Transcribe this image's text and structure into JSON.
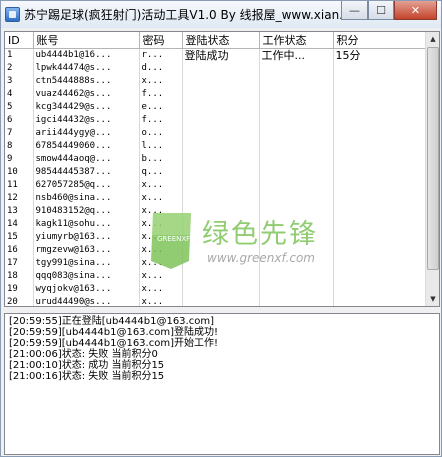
{
  "window": {
    "title": "苏宁踢足球(疯狂射门)活动工具V1.0 By 线报屋_www.xian...",
    "minimize_glyph": "—",
    "maximize_glyph": "☐",
    "close_glyph": "✕"
  },
  "grid": {
    "headers": [
      "ID",
      "账号",
      "密码",
      "登陆状态",
      "工作状态",
      "积分"
    ],
    "rows": [
      {
        "id": "1",
        "account": "ub4444b1@16...",
        "password": "r...",
        "login_status": "登陆成功",
        "work_status": "工作中...",
        "points": "15分"
      },
      {
        "id": "2",
        "account": "lpwk44474@s...",
        "password": "d...",
        "login_status": "",
        "work_status": "",
        "points": ""
      },
      {
        "id": "3",
        "account": "ctn5444888s...",
        "password": "x...",
        "login_status": "",
        "work_status": "",
        "points": ""
      },
      {
        "id": "4",
        "account": "vuaz44462@s...",
        "password": "f...",
        "login_status": "",
        "work_status": "",
        "points": ""
      },
      {
        "id": "5",
        "account": "kcg344429@s...",
        "password": "e...",
        "login_status": "",
        "work_status": "",
        "points": ""
      },
      {
        "id": "6",
        "account": "igci44432@s...",
        "password": "f...",
        "login_status": "",
        "work_status": "",
        "points": ""
      },
      {
        "id": "7",
        "account": "arii444ygy@...",
        "password": "o...",
        "login_status": "",
        "work_status": "",
        "points": ""
      },
      {
        "id": "8",
        "account": "67854449060...",
        "password": "l...",
        "login_status": "",
        "work_status": "",
        "points": ""
      },
      {
        "id": "9",
        "account": "smow444aoq@...",
        "password": "b...",
        "login_status": "",
        "work_status": "",
        "points": ""
      },
      {
        "id": "10",
        "account": "98544445387...",
        "password": "q...",
        "login_status": "",
        "work_status": "",
        "points": ""
      },
      {
        "id": "11",
        "account": "627057285@q...",
        "password": "x...",
        "login_status": "",
        "work_status": "",
        "points": ""
      },
      {
        "id": "12",
        "account": "nsb460@sina...",
        "password": "x...",
        "login_status": "",
        "work_status": "",
        "points": ""
      },
      {
        "id": "13",
        "account": "910483152@q...",
        "password": "x...",
        "login_status": "",
        "work_status": "",
        "points": ""
      },
      {
        "id": "14",
        "account": "kagk11@sohu...",
        "password": "x...",
        "login_status": "",
        "work_status": "",
        "points": ""
      },
      {
        "id": "15",
        "account": "yiumyrb@163...",
        "password": "x...",
        "login_status": "",
        "work_status": "",
        "points": ""
      },
      {
        "id": "16",
        "account": "rmgzevw@163...",
        "password": "x...",
        "login_status": "",
        "work_status": "",
        "points": ""
      },
      {
        "id": "17",
        "account": "tgy991@sina...",
        "password": "x...",
        "login_status": "",
        "work_status": "",
        "points": ""
      },
      {
        "id": "18",
        "account": "qqq083@sina...",
        "password": "x...",
        "login_status": "",
        "work_status": "",
        "points": ""
      },
      {
        "id": "19",
        "account": "wyqjokv@163...",
        "password": "x...",
        "login_status": "",
        "work_status": "",
        "points": ""
      },
      {
        "id": "20",
        "account": "urud44490@s...",
        "password": "x...",
        "login_status": "",
        "work_status": "",
        "points": ""
      }
    ]
  },
  "scrollbar": {
    "up_glyph": "▲",
    "down_glyph": "▼"
  },
  "watermark": {
    "logo_text": "GREENXF .COM",
    "brand_cn": "绿色先锋",
    "url": "www.greenxf.com"
  },
  "log": {
    "lines": [
      "[20:59:55]正在登陆[ub4444b1@163.com]",
      "[20:59:59][ub4444b1@163.com]登陆成功!",
      "[20:59:59][ub4444b1@163.com]开始工作!",
      "[21:00:06]状态: 失败  当前积分0",
      "[21:00:10]状态: 成功  当前积分15",
      "[21:00:16]状态: 失败  当前积分15"
    ]
  },
  "colors": {
    "watermark_green": "#7ec45a",
    "close_button": "#c4432b"
  }
}
